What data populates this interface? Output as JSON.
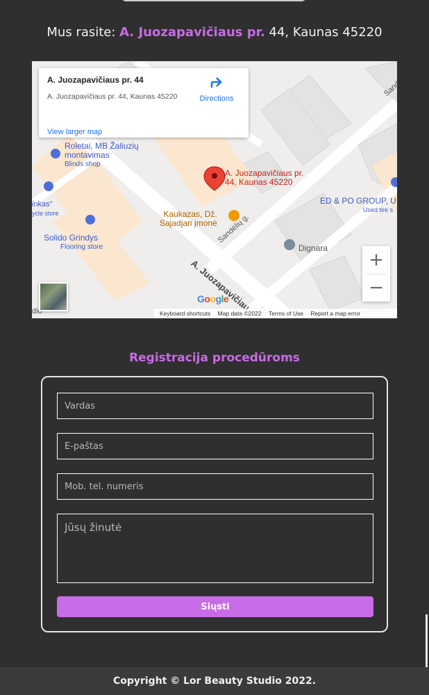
{
  "address": {
    "prefix": "Mus rasite:",
    "street": "A. Juozapavičiaus pr.",
    "rest": "44, Kaunas 45220"
  },
  "map": {
    "card_title": "A. Juozapavičiaus pr. 44",
    "card_address": "A. Juozapavičiaus pr. 44, Kaunas 45220",
    "view_larger": "View larger map",
    "directions": "Directions",
    "pin_label_1": "A. Juozapavičiaus pr.",
    "pin_label_2": "44, Kaunas 45220",
    "poi": {
      "roletai_1": "Roletai, MB Žaliuzių",
      "roletai_2": "montavimas",
      "roletai_3": "Blinds shop",
      "ninkas_1": "inkas\"",
      "ninkas_2": "ycle store",
      "solido_1": "Solido Grindys",
      "solido_2": "Flooring store",
      "kaukazas_1": "Kaukazas, Dž.",
      "kaukazas_2": "Sajadjan įmonė",
      "edpo_1": "ED & PO GROUP, U",
      "edpo_2": "Used tire s",
      "dignara": "Dignara",
      "sandeliu": "Sandėlių g.",
      "sand_top": "Sand",
      "street": "A. Juozapavičiau",
      "dio": "dio"
    },
    "google": "Google",
    "keyboard": "Keyboard shortcuts",
    "map_data": "Map data ©2022",
    "terms": "Terms of Use",
    "report": "Report a map error",
    "zoom_in": "+",
    "zoom_out": "−"
  },
  "registration": {
    "title": "Registracija procedūroms",
    "name_placeholder": "Vardas",
    "email_placeholder": "E-paštas",
    "phone_placeholder": "Mob. tel. numeris",
    "message_placeholder": "Jūsų žinutė",
    "submit": "Siųsti"
  },
  "footer": {
    "copyright": "Copyright © Lor Beauty Studio 2022."
  },
  "colors": {
    "accent": "#c86be6",
    "background": "#2f2f2f",
    "pin": "#ea4335",
    "link": "#1a73e8"
  }
}
